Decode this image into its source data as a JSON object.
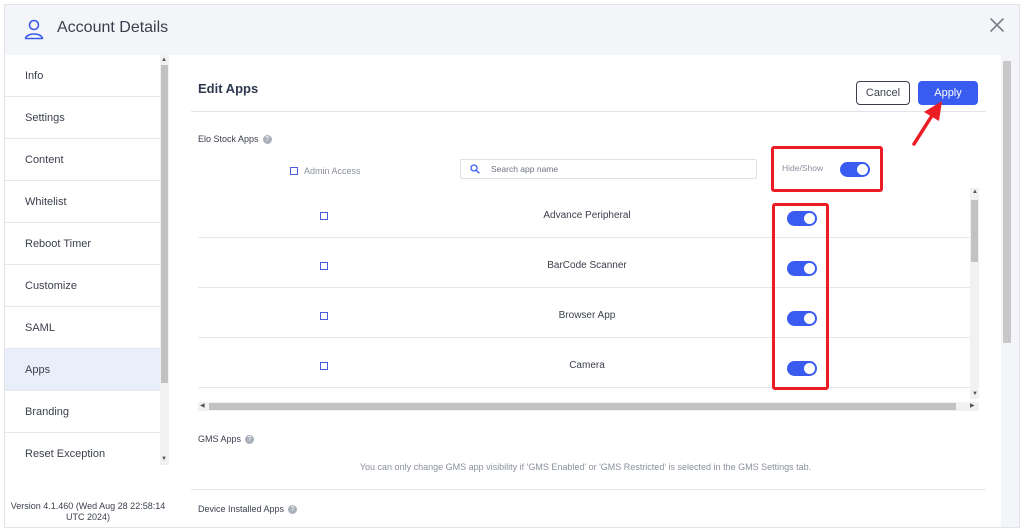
{
  "window": {
    "title": "Account Details",
    "title_icon": "user-icon",
    "close_icon": "close-icon"
  },
  "sidebar": {
    "items": [
      {
        "label": "Info"
      },
      {
        "label": "Settings"
      },
      {
        "label": "Content"
      },
      {
        "label": "Whitelist"
      },
      {
        "label": "Reboot Timer"
      },
      {
        "label": "Customize"
      },
      {
        "label": "SAML"
      },
      {
        "label": "Apps",
        "active": true
      },
      {
        "label": "Branding"
      },
      {
        "label": "Reset Exception"
      }
    ],
    "version": "Version 4.1.460 (Wed Aug 28 22:58:14 UTC 2024)"
  },
  "edit_apps": {
    "title": "Edit Apps",
    "cancel_label": "Cancel",
    "apply_label": "Apply",
    "elo_section": {
      "label": "Elo Stock Apps",
      "admin_access_label": "Admin Access",
      "admin_access_checked": false,
      "search_placeholder": "Search app name",
      "search_value": "",
      "hide_show_label": "Hide/Show",
      "hide_show_on": true,
      "apps": [
        {
          "name": "Advance Peripheral",
          "checked": false,
          "visible": true
        },
        {
          "name": "BarCode Scanner",
          "checked": false,
          "visible": true
        },
        {
          "name": "Browser App",
          "checked": false,
          "visible": true
        },
        {
          "name": "Camera",
          "checked": false,
          "visible": true
        }
      ]
    },
    "gms_section": {
      "label": "GMS Apps",
      "note": "You can only change GMS app visibility if 'GMS Enabled' or 'GMS Restricted' is selected in the GMS Settings tab."
    },
    "device_section": {
      "label": "Device Installed Apps"
    }
  },
  "colors": {
    "accent": "#3a5bf0",
    "annotation": "#ec1c24"
  }
}
